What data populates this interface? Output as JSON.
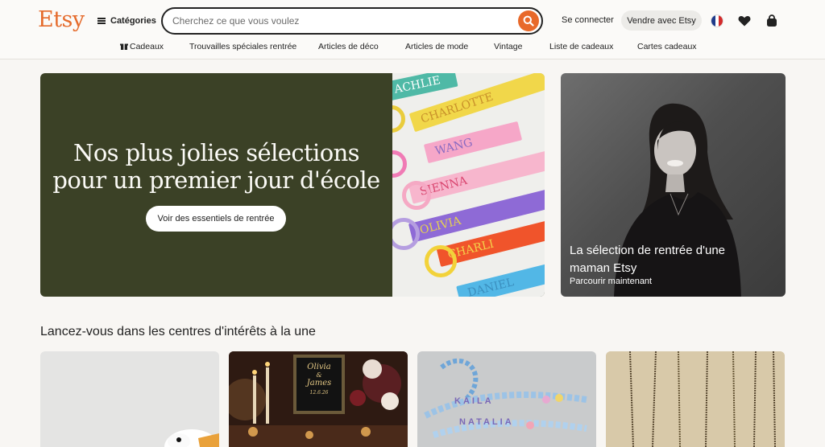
{
  "header": {
    "logo": "Etsy",
    "categories_label": "Catégories",
    "search_placeholder": "Cherchez ce que vous voulez",
    "sign_in": "Se connecter",
    "sell": "Vendre avec Etsy"
  },
  "nav": {
    "items": [
      "Cadeaux",
      "Trouvailles spéciales rentrée",
      "Articles de déco",
      "Articles de mode",
      "Vintage",
      "Liste de cadeaux",
      "Cartes cadeaux"
    ]
  },
  "hero": {
    "title_line1": "Nos plus jolies sélections",
    "title_line2": "pour un premier jour d'école",
    "cta": "Voir des essentiels de rentrée",
    "tag_names": [
      "ACHLIE",
      "CHARLOTTE",
      "WANG",
      "SIENNA",
      "OLIVIA",
      "CHARLI",
      "DANIEL"
    ]
  },
  "promo": {
    "title": "La sélection de rentrée d'une maman Etsy",
    "subtitle": "Parcourir maintenant"
  },
  "section": {
    "title": "Lancez-vous dans les centres d'intérêts à la une"
  },
  "tiles": {
    "wedding_sign_name1": "Olivia",
    "wedding_sign_amp": "&",
    "wedding_sign_name2": "James",
    "wedding_sign_date": "12.6.26",
    "bracelet_word1": "KAILA",
    "bracelet_word2": "NATALIA"
  },
  "colors": {
    "brand": "#e56b2c",
    "hero_bg": "#3b4126",
    "page_bg": "#f8f6f3"
  },
  "icons": [
    "hamburger-icon",
    "search-icon",
    "gift-icon",
    "france-flag-icon",
    "heart-icon",
    "bag-icon"
  ]
}
